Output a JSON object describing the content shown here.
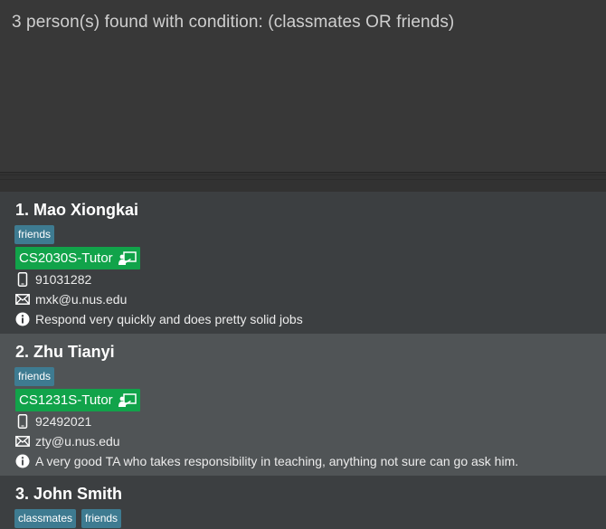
{
  "result": {
    "message": "3 person(s) found with condition: (classmates OR friends)"
  },
  "persons": [
    {
      "name": "1. Mao Xiongkai",
      "tags": [
        "friends"
      ],
      "tutor": "CS2030S-Tutor",
      "phone": "91031282",
      "email": "mxk@u.nus.edu",
      "remark": "Respond very quickly and does pretty solid jobs"
    },
    {
      "name": "2. Zhu Tianyi",
      "tags": [
        "friends"
      ],
      "tutor": "CS1231S-Tutor",
      "phone": "92492021",
      "email": "zty@u.nus.edu",
      "remark": "A very good TA who takes responsibility in teaching, anything not sure can go ask him."
    },
    {
      "name": "3. John Smith",
      "tags": [
        "classmates",
        "friends"
      ]
    }
  ],
  "icons": {
    "tutor": "teacher-board-icon",
    "phone": "mobile-phone-icon",
    "email": "envelope-icon",
    "remark": "info-icon"
  },
  "colors": {
    "tag": "#3e7b91",
    "tutor": "#11a34a",
    "card_odd": "#3c3f41",
    "card_even": "#505456"
  }
}
